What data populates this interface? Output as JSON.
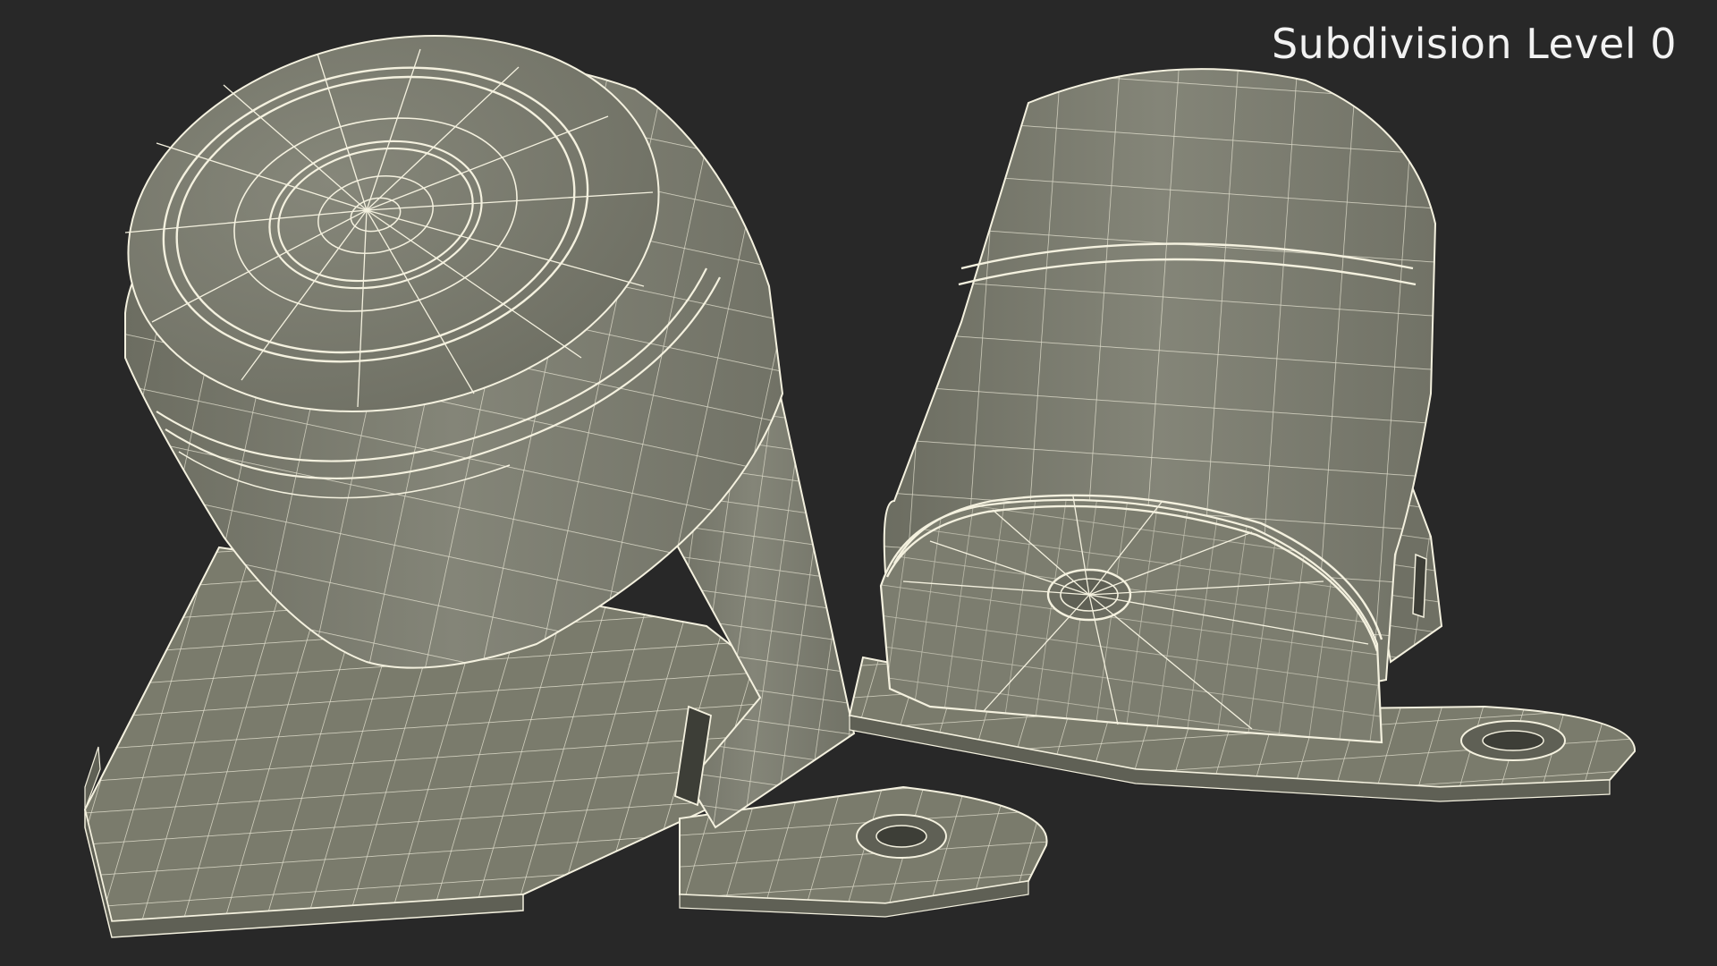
{
  "render": {
    "label": "Subdivision Level 0",
    "subject": "mounting-bracket-wireframe"
  },
  "colors": {
    "background": "#282828",
    "surface": "#7a7b6c",
    "surface_light": "#8b8c7d",
    "surface_dark": "#5f6055",
    "wire": "#f4f1df",
    "label_text": "#f2f2f2"
  }
}
